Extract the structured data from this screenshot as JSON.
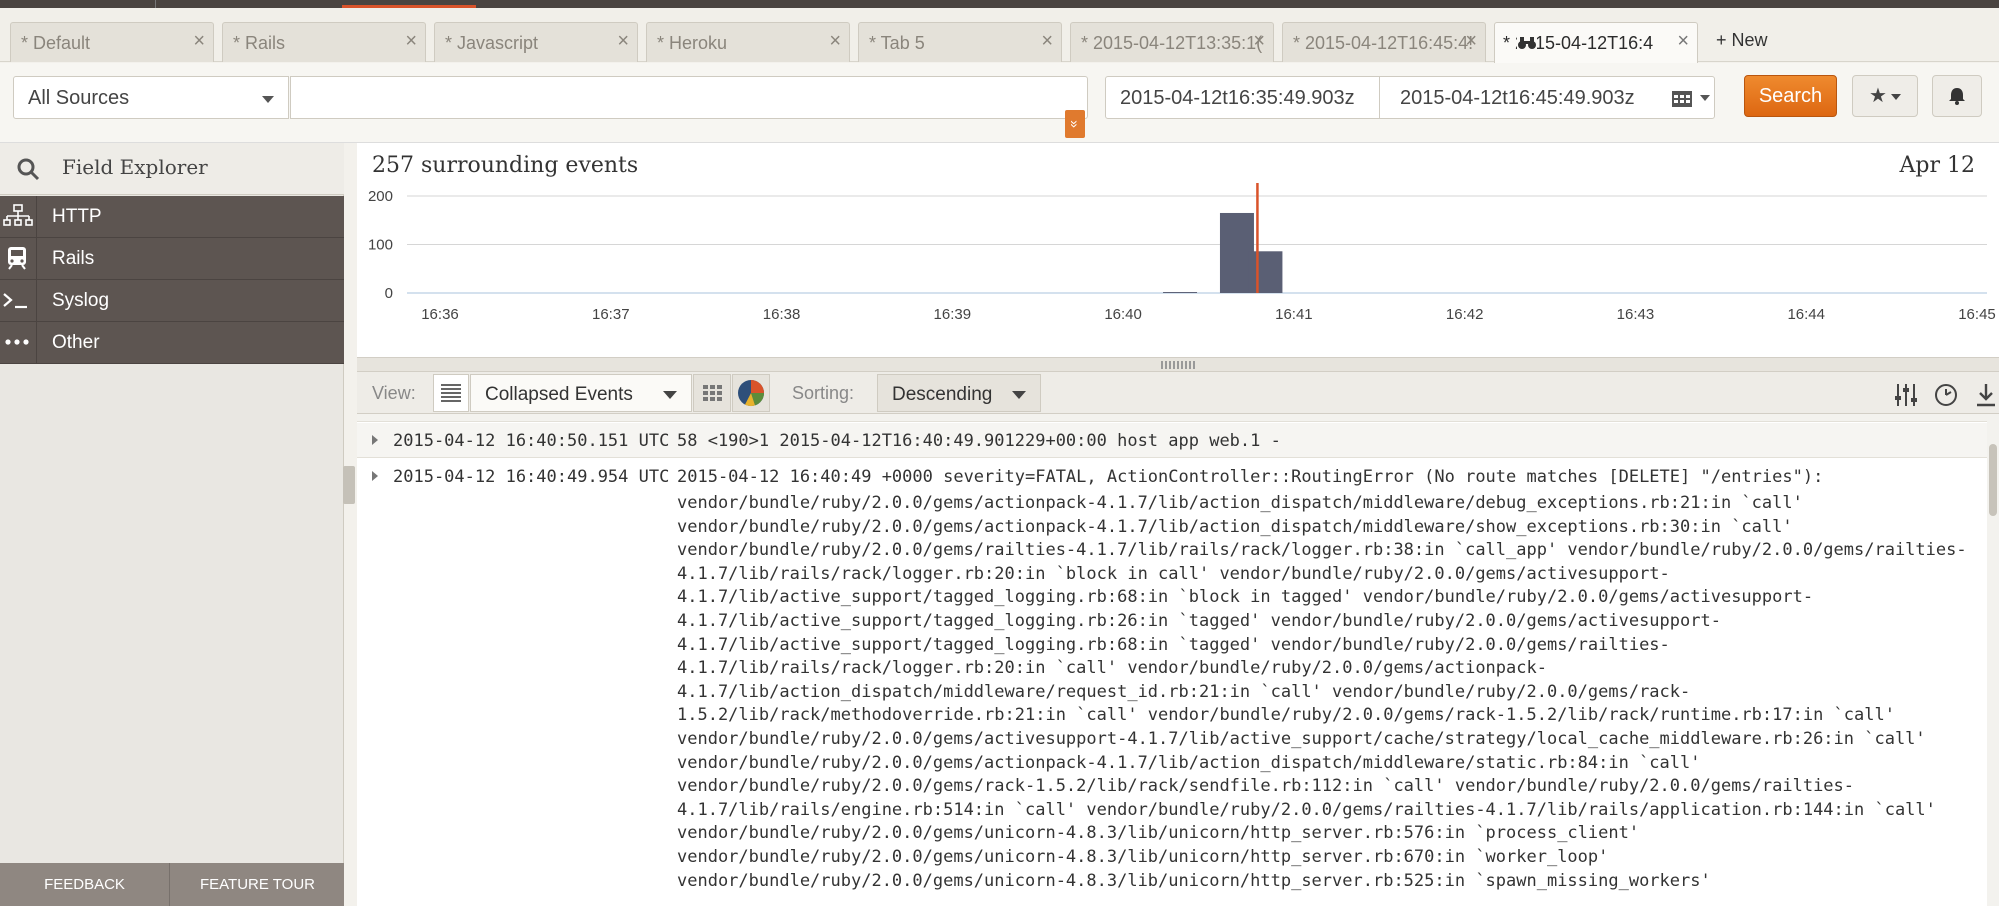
{
  "tabs": [
    {
      "label": "* Default"
    },
    {
      "label": "* Rails"
    },
    {
      "label": "* Javascript"
    },
    {
      "label": "* Heroku"
    },
    {
      "label": "* Tab 5"
    },
    {
      "label": "* 2015-04-12T13:35:1("
    },
    {
      "label": "* 2015-04-12T16:45:4!"
    },
    {
      "label": "* 2015-04-12T16:4"
    }
  ],
  "tab_close": "×",
  "new_tab": "+ New",
  "search": {
    "source": "All Sources",
    "query": "",
    "from": "2015-04-12t16:35:49.903z",
    "to": "2015-04-12t16:45:49.903z",
    "button": "Search",
    "star": "★",
    "expand": "»"
  },
  "sidebar": {
    "title": "Field Explorer",
    "items": [
      {
        "label": "HTTP",
        "icon": "sitemap-icon"
      },
      {
        "label": "Rails",
        "icon": "train-icon"
      },
      {
        "label": "Syslog",
        "icon": "terminal-icon"
      },
      {
        "label": "Other",
        "icon": "ellipsis-icon"
      }
    ],
    "feedback": "FEEDBACK",
    "tour": "FEATURE TOUR"
  },
  "chart": {
    "title": "257 surrounding events",
    "date": "Apr 12"
  },
  "chart_data": {
    "type": "bar",
    "title": "257 surrounding events",
    "yticks": [
      0,
      100,
      200
    ],
    "ylim": [
      0,
      200
    ],
    "xticks": [
      "16:36",
      "16:37",
      "16:38",
      "16:39",
      "16:40",
      "16:41",
      "16:42",
      "16:43",
      "16:44",
      "16:45"
    ],
    "bars": [
      {
        "x": "16:40:20",
        "value": 2
      },
      {
        "x": "16:40:40",
        "value": 165
      },
      {
        "x": "16:40:50",
        "value": 86
      }
    ],
    "marker": "16:40:50",
    "accent": "#d9532a",
    "bar_color": "#5a5f74"
  },
  "viewbar": {
    "view_label": "View:",
    "view_value": "Collapsed Events",
    "sort_label": "Sorting:",
    "sort_value": "Descending"
  },
  "events": [
    {
      "timestamp": "2015-04-12 16:40:50.151 UTC",
      "message": "58 <190>1 2015-04-12T16:40:49.901229+00:00 host app web.1 -"
    },
    {
      "timestamp": "2015-04-12 16:40:49.954 UTC",
      "message": "2015-04-12 16:40:49 +0000 severity=FATAL, ActionController::RoutingError (No route matches [DELETE] \"/entries\"):",
      "trace": "vendor/bundle/ruby/2.0.0/gems/actionpack-4.1.7/lib/action_dispatch/middleware/debug_exceptions.rb:21:in `call'\nvendor/bundle/ruby/2.0.0/gems/actionpack-4.1.7/lib/action_dispatch/middleware/show_exceptions.rb:30:in `call'\nvendor/bundle/ruby/2.0.0/gems/railties-4.1.7/lib/rails/rack/logger.rb:38:in `call_app' vendor/bundle/ruby/2.0.0/gems/railties-\n4.1.7/lib/rails/rack/logger.rb:20:in `block in call' vendor/bundle/ruby/2.0.0/gems/activesupport-\n4.1.7/lib/active_support/tagged_logging.rb:68:in `block in tagged' vendor/bundle/ruby/2.0.0/gems/activesupport-\n4.1.7/lib/active_support/tagged_logging.rb:26:in `tagged' vendor/bundle/ruby/2.0.0/gems/activesupport-\n4.1.7/lib/active_support/tagged_logging.rb:68:in `tagged' vendor/bundle/ruby/2.0.0/gems/railties-\n4.1.7/lib/rails/rack/logger.rb:20:in `call' vendor/bundle/ruby/2.0.0/gems/actionpack-\n4.1.7/lib/action_dispatch/middleware/request_id.rb:21:in `call' vendor/bundle/ruby/2.0.0/gems/rack-\n1.5.2/lib/rack/methodoverride.rb:21:in `call' vendor/bundle/ruby/2.0.0/gems/rack-1.5.2/lib/rack/runtime.rb:17:in `call'\nvendor/bundle/ruby/2.0.0/gems/activesupport-4.1.7/lib/active_support/cache/strategy/local_cache_middleware.rb:26:in `call'\nvendor/bundle/ruby/2.0.0/gems/actionpack-4.1.7/lib/action_dispatch/middleware/static.rb:84:in `call'\nvendor/bundle/ruby/2.0.0/gems/rack-1.5.2/lib/rack/sendfile.rb:112:in `call' vendor/bundle/ruby/2.0.0/gems/railties-\n4.1.7/lib/rails/engine.rb:514:in `call' vendor/bundle/ruby/2.0.0/gems/railties-4.1.7/lib/rails/application.rb:144:in `call'\nvendor/bundle/ruby/2.0.0/gems/unicorn-4.8.3/lib/unicorn/http_server.rb:576:in `process_client'\nvendor/bundle/ruby/2.0.0/gems/unicorn-4.8.3/lib/unicorn/http_server.rb:670:in `worker_loop'\nvendor/bundle/ruby/2.0.0/gems/unicorn-4.8.3/lib/unicorn/http_server.rb:525:in `spawn_missing_workers'"
    }
  ]
}
